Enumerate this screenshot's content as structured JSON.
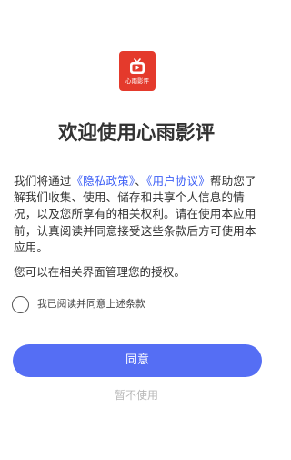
{
  "app": {
    "logo_text": "心雨影评",
    "logo_icon": "tv-icon",
    "brand_color": "#e43a2c"
  },
  "title": "欢迎使用心雨影评",
  "desc": {
    "part1": "我们将通过",
    "privacy_link": "《隐私政策》",
    "sep": "、",
    "user_link": "《用户协议》",
    "part2": "帮助您了解我们收集、使用、储存和共享个人信息的情况，以及您所享有的相关权利。请在使用本应用前，认真阅读并同意接受这些条款后方可使用本应用。"
  },
  "desc2": "您可以在相关界面管理您的授权。",
  "agree_label": "我已阅读并同意上述条款",
  "agree_checked": false,
  "agree_button": "同意",
  "disagree_button": "暂不使用",
  "colors": {
    "accent": "#556ef4",
    "link": "#3d5ff6",
    "text": "#333333",
    "muted": "#b8b8b8"
  }
}
